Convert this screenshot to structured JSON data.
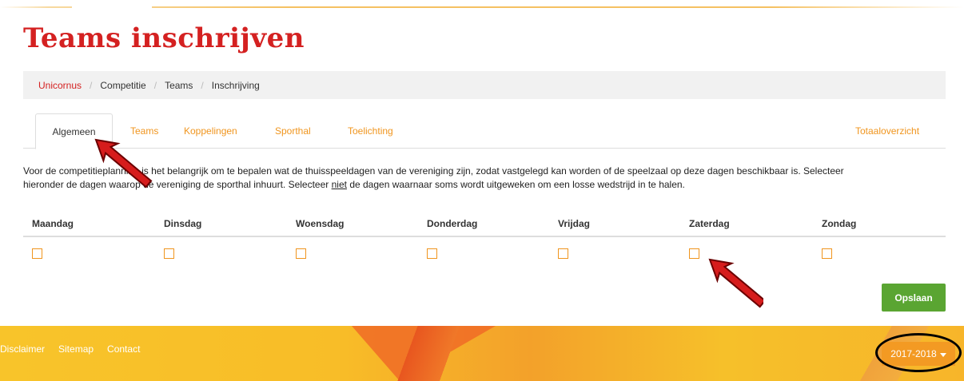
{
  "page": {
    "title": "Teams inschrijven"
  },
  "breadcrumb": [
    {
      "label": "Unicornus"
    },
    {
      "label": "Competitie"
    },
    {
      "label": "Teams"
    },
    {
      "label": "Inschrijving"
    }
  ],
  "tabs": [
    {
      "label": "Algemeen",
      "active": true
    },
    {
      "label": "Teams"
    },
    {
      "label": "Koppelingen"
    },
    {
      "label": "Sporthal"
    },
    {
      "label": "Toelichting"
    },
    {
      "label": "Totaaloverzicht"
    }
  ],
  "intro": {
    "line1": "Voor de competitieplanning is het belangrijk om te bepalen wat de thuisspeeldagen van de vereniging zijn, zodat vastgelegd kan worden of de speelzaal op deze dagen beschikbaar is. Selecteer",
    "line2_a": "hieronder de dagen waarop de vereniging de sporthal inhuurt. Selecteer",
    "line2_u": "niet",
    "line2_b": "de dagen waarnaar soms wordt uitgeweken om een losse wedstrijd in te halen."
  },
  "days": [
    {
      "label": "Maandag",
      "checked": false
    },
    {
      "label": "Dinsdag",
      "checked": false
    },
    {
      "label": "Woensdag",
      "checked": false
    },
    {
      "label": "Donderdag",
      "checked": false
    },
    {
      "label": "Vrijdag",
      "checked": false
    },
    {
      "label": "Zaterdag",
      "checked": false
    },
    {
      "label": "Zondag",
      "checked": false
    }
  ],
  "actions": {
    "save_label": "Opslaan"
  },
  "footer": {
    "links": [
      {
        "label": "Disclaimer"
      },
      {
        "label": "Sitemap"
      },
      {
        "label": "Contact"
      }
    ],
    "season": "2017-2018"
  },
  "colors": {
    "brand_red": "#d42121",
    "tab_orange": "#f0951e",
    "save_green": "#5aa532",
    "footer_yellow": "#f8c42a",
    "annotation_arrow": "#d61c1c",
    "annotation_oval": "#000000"
  },
  "icons": {
    "season_dropdown": "caret-down-icon",
    "annotation": "arrow-annotation-icon"
  }
}
